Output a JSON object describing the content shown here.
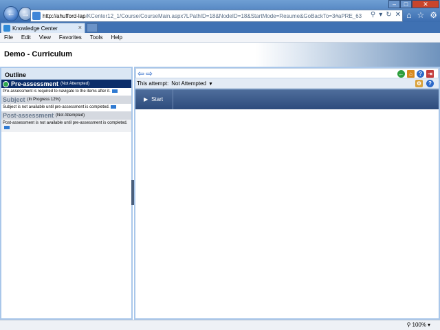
{
  "browser": {
    "url_host": "http://ahufford-lap",
    "url_path": "/KCenter12_1/Course/CourseMain.aspx?LPathID=18&NodeID=18&StartMode=Resume&GoBackTo=3#aPRE_63",
    "tab_title": "Knowledge Center",
    "menu": [
      "File",
      "Edit",
      "View",
      "Favorites",
      "Tools",
      "Help"
    ],
    "zoom": "100%"
  },
  "page": {
    "title": "Demo - Curriculum"
  },
  "outline": {
    "header": "Outline",
    "items": [
      {
        "title": "Pre-assessment",
        "status": "(Not Attempted)",
        "description": "Pre-assessment is required to navigate to the items after it."
      },
      {
        "title": "Subject",
        "status": "(In Progress 12%)",
        "description": "Subject is not available until pre-assessment is completed."
      },
      {
        "title": "Post-assessment",
        "status": "(Not Attempted)",
        "description": "Post-assessment is not available until pre-assessment is completed."
      }
    ]
  },
  "attempt": {
    "label": "This attempt:",
    "value": "Not Attempted"
  },
  "content": {
    "start_label": "Start"
  },
  "colors": {
    "accent": "#0b2d6a",
    "panel": "#a9c7ea"
  }
}
